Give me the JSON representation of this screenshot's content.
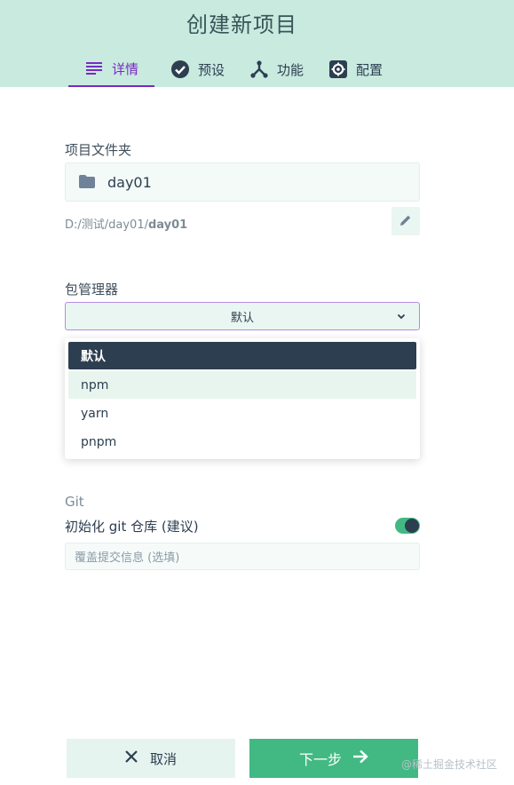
{
  "header": {
    "title": "创建新项目",
    "tabs": [
      {
        "label": "详情",
        "icon": "list-icon",
        "active": true
      },
      {
        "label": "预设",
        "icon": "check-circle-icon",
        "active": false
      },
      {
        "label": "功能",
        "icon": "fork-icon",
        "active": false
      },
      {
        "label": "配置",
        "icon": "gear-icon",
        "active": false
      }
    ]
  },
  "folder": {
    "label": "项目文件夹",
    "value": "day01",
    "path_prefix": "D:/测试/day01/",
    "path_bold": "day01"
  },
  "package_manager": {
    "label": "包管理器",
    "selected": "默认",
    "options": [
      "默认",
      "npm",
      "yarn",
      "pnpm"
    ]
  },
  "git": {
    "label": "Git",
    "init_label": "初始化 git 仓库 (建议)",
    "init_enabled": true,
    "commit_placeholder": "覆盖提交信息 (选填)"
  },
  "footer": {
    "cancel_label": "取消",
    "next_label": "下一步",
    "watermark": "@稀土掘金技术社区"
  },
  "colors": {
    "header_bg": "#c8eadf",
    "accent_purple": "#7a2ac0",
    "primary_green": "#42b983",
    "dark": "#2c3e50"
  }
}
